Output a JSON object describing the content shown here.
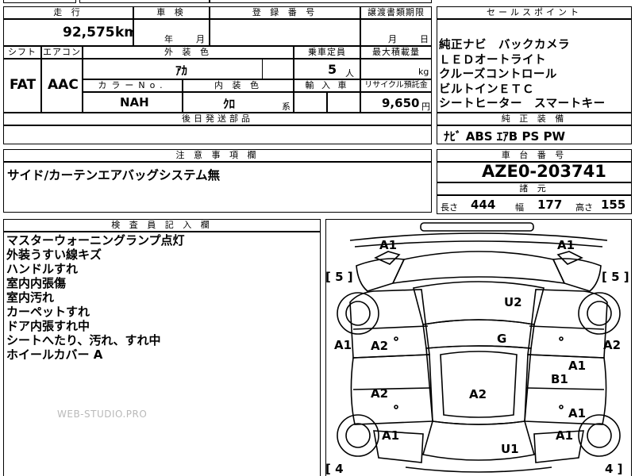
{
  "headers": {
    "mileage": "走 行",
    "inspection": "車 検",
    "registration_no": "登 録 番 号",
    "transfer_deadline": "譲渡書類期限",
    "sales_points": "セールスポイント",
    "shift": "シフト",
    "aircon": "エアコン",
    "exterior_color": "外 装 色",
    "capacity": "乗車定員",
    "max_load": "最大積載量",
    "color_no": "カラーNo.",
    "interior_color": "内 装 色",
    "import": "輸 入 車",
    "recycle_fee": "リサイクル預託金",
    "later_parts": "後日発送部品",
    "standard_equipment": "純 正 装 備",
    "notes": "注 意 事 項 欄",
    "chassis_no": "車 台 番 号",
    "specs": "諸 元",
    "inspector": "検 査 員 記 入 欄"
  },
  "vehicle": {
    "mileage_value": "92,575",
    "mileage_unit": "km",
    "inspection_year": "年",
    "inspection_month": "月",
    "transfer_month": "月",
    "transfer_day": "日",
    "shift": "FAT",
    "aircon": "AAC",
    "exterior_color": "ｱｶ",
    "capacity": "5",
    "capacity_unit": "人",
    "load_unit": "kg",
    "color_no": "NAH",
    "interior_color": "ｸﾛ",
    "interior_suffix": "系",
    "recycle_fee": "9,650",
    "recycle_unit": "円",
    "chassis_no": "AZE0-203741"
  },
  "sales_points": [
    "純正ナビ　バックカメラ",
    "ＬＥＤオートライト",
    "クルーズコントロール",
    "ビルトインＥＴＣ",
    "シートヒーター　スマートキー"
  ],
  "equipment": "ﾅﾋﾞ ABS ｴｱB PS PW",
  "notes_text": "サイド/カーテンエアバッグシステム無",
  "specs": {
    "length_label": "長さ",
    "length": "444",
    "width_label": "幅",
    "width": "177",
    "height_label": "高さ",
    "height": "155"
  },
  "inspector_notes": [
    "マスターウォーニングランプ点灯",
    "外装うすい線キズ",
    "ハンドルすれ",
    "室内内張傷",
    "室内汚れ",
    "カーペットすれ",
    "ドア内張すれ中",
    "シートへたり、汚れ、すれ中",
    "ホイールカバー A"
  ],
  "diagram": {
    "front_left": "A1",
    "front_right": "A1",
    "tire_front_left": "[ 5 ]",
    "tire_front_right": "[ 5 ]",
    "windshield": "U2",
    "roof": "G",
    "fender_left": "A1",
    "fender_right": "A2",
    "door_front_left": "A2",
    "door_rear_left": "A2",
    "door_right_front": "A1",
    "door_right_mid": "B1",
    "door_right_rear": "A1",
    "floor": "A2",
    "rear_left": "A1",
    "rear_right": "A1",
    "rear_glass": "U1",
    "tire_rear_left": "[ 4",
    "tire_rear_right": "4 ]"
  },
  "watermark": "WEB-STUDIO.PRO"
}
